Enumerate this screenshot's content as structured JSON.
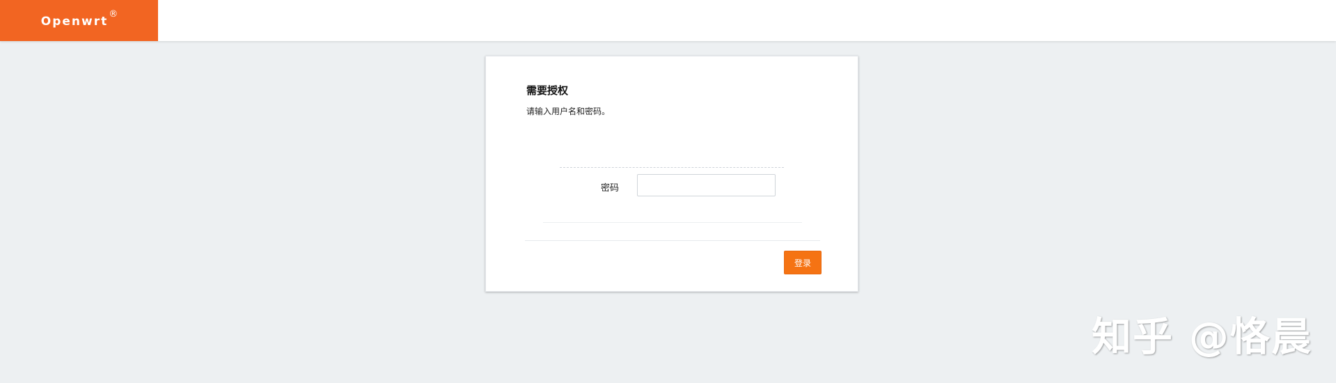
{
  "header": {
    "brand": "Openwrt",
    "brand_reg": "®"
  },
  "login": {
    "title": "需要授权",
    "description": "请输入用户名和密码。",
    "password_label": "密码",
    "password_value": "",
    "submit_label": "登录"
  },
  "watermark": {
    "text": "知乎 @恪晨"
  },
  "colors": {
    "brand": "#f26522",
    "button": "#f57313",
    "page_background": "#edf0f2"
  }
}
